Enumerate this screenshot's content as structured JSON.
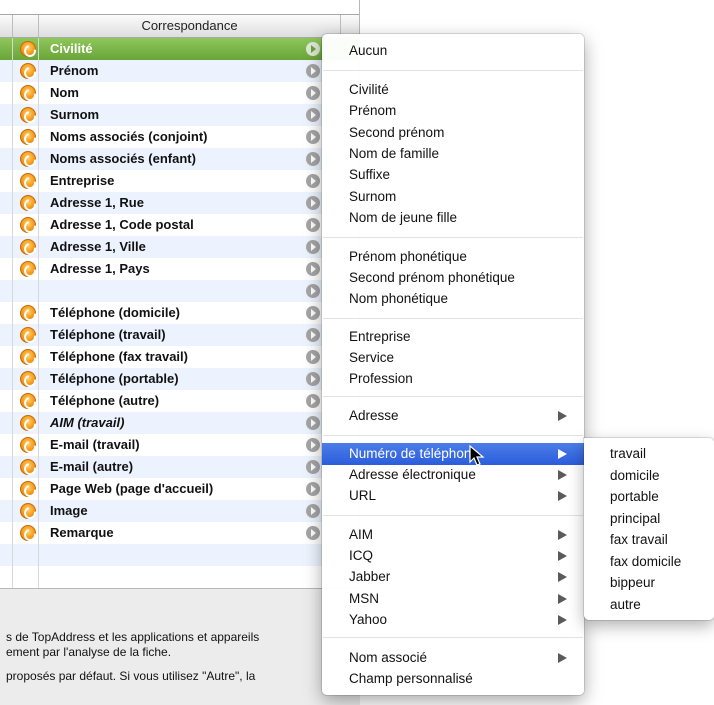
{
  "table": {
    "header": "Correspondance",
    "rows": [
      {
        "label": "Civilité",
        "selected": true
      },
      {
        "label": "Prénom"
      },
      {
        "label": "Nom"
      },
      {
        "label": "Surnom"
      },
      {
        "label": "Noms associés (conjoint)"
      },
      {
        "label": "Noms associés (enfant)"
      },
      {
        "label": "Entreprise"
      },
      {
        "label": "Adresse 1, Rue"
      },
      {
        "label": "Adresse 1, Code postal"
      },
      {
        "label": "Adresse 1, Ville"
      },
      {
        "label": "Adresse 1, Pays"
      },
      {
        "label": ""
      },
      {
        "label": "Téléphone (domicile)"
      },
      {
        "label": "Téléphone (travail)"
      },
      {
        "label": "Téléphone (fax travail)"
      },
      {
        "label": "Téléphone (portable)"
      },
      {
        "label": "Téléphone (autre)"
      },
      {
        "label": "AIM (travail)",
        "italic": true
      },
      {
        "label": "E-mail (travail)"
      },
      {
        "label": "E-mail (autre)"
      },
      {
        "label": "Page Web (page d'accueil)"
      },
      {
        "label": "Image"
      },
      {
        "label": "Remarque"
      }
    ]
  },
  "info": {
    "line1": "s de TopAddress et les applications et appareils",
    "line2": "ement par l'analyse de la fiche.",
    "line3": "proposés par défaut. Si vous utilisez \"Autre\", la"
  },
  "menu": {
    "items": {
      "aucun": "Aucun",
      "civilite": "Civilité",
      "prenom": "Prénom",
      "second_prenom": "Second prénom",
      "nom_de_famille": "Nom de famille",
      "suffixe": "Suffixe",
      "surnom": "Surnom",
      "nom_jeune_fille": "Nom de jeune fille",
      "prenom_phonetique": "Prénom phonétique",
      "second_prenom_phonetique": "Second prénom phonétique",
      "nom_phonetique": "Nom phonétique",
      "entreprise": "Entreprise",
      "service": "Service",
      "profession": "Profession",
      "adresse": "Adresse",
      "numero_telephone": "Numéro de téléphone",
      "adresse_electronique": "Adresse électronique",
      "url": "URL",
      "aim": "AIM",
      "icq": "ICQ",
      "jabber": "Jabber",
      "msn": "MSN",
      "yahoo": "Yahoo",
      "nom_associe": "Nom associé",
      "champ_personnalise": "Champ personnalisé"
    }
  },
  "submenu": {
    "items": [
      "travail",
      "domicile",
      "portable",
      "principal",
      "fax travail",
      "fax domicile",
      "bippeur",
      "autre"
    ]
  },
  "colors": {
    "selection_green": "#6aa53a",
    "menu_highlight": "#2a5ddb",
    "status_orange": "#f79a17"
  },
  "icons": {
    "row_status": "orange-sync-icon",
    "row_menu": "gray-disclosure-icon",
    "submenu_arrow": "triangle-right-icon",
    "cursor": "arrow-cursor-icon"
  }
}
